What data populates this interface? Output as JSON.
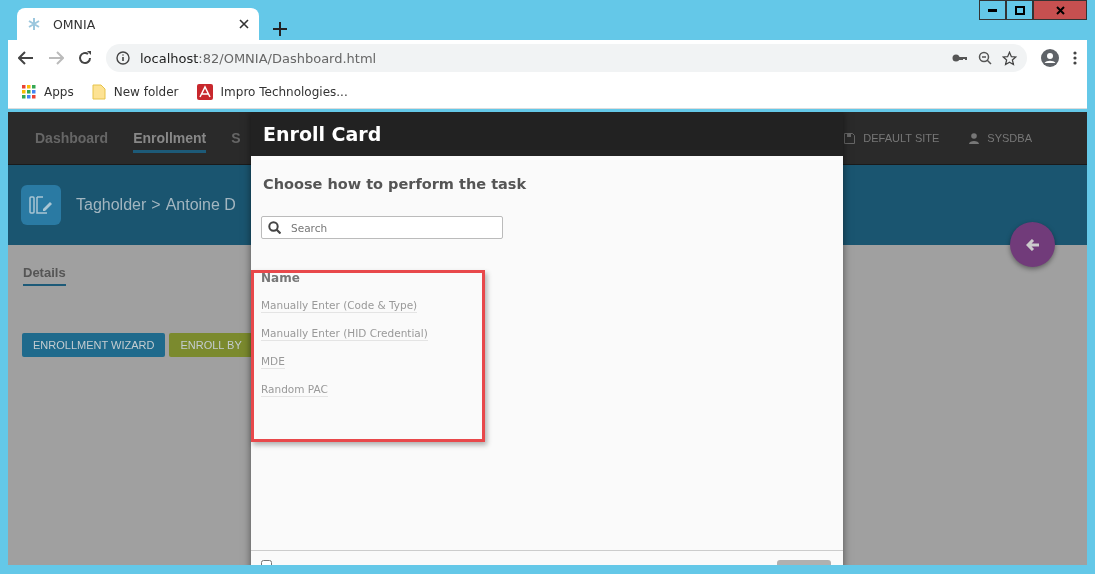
{
  "browser": {
    "tab_title": "OMNIA",
    "url_host": "localhost",
    "url_path": ":82/OMNIA/Dashboard.html",
    "bookmarks": [
      {
        "kind": "apps",
        "label": "Apps"
      },
      {
        "kind": "folder",
        "label": "New folder"
      },
      {
        "kind": "site",
        "label": "Impro Technologies..."
      }
    ]
  },
  "app": {
    "nav": [
      {
        "label": "Dashboard",
        "selected": false
      },
      {
        "label": "Enrollment",
        "selected": true
      },
      {
        "label": "S",
        "selected": false
      }
    ],
    "site": "DEFAULT SITE",
    "user": "SYSDBA",
    "breadcrumb": [
      "Tagholder",
      ">",
      "Antoine D"
    ],
    "tabs": [
      {
        "label": "Details",
        "selected": true
      }
    ],
    "buttons": [
      {
        "label": "ENROLLMENT WIZARD",
        "color": "#1f6a8c"
      },
      {
        "label": "ENROLL BY",
        "color": "#7b8a2e"
      }
    ]
  },
  "modal": {
    "title": "Enroll Card",
    "subtitle": "Choose how to perform the task",
    "search": {
      "placeholder": "Search"
    },
    "column": "Name",
    "options": [
      "Manually Enter (Code & Type)",
      "Manually Enter (HID Credential)",
      "MDE",
      "Random PAC"
    ],
    "footer": {
      "checked": false
    }
  }
}
